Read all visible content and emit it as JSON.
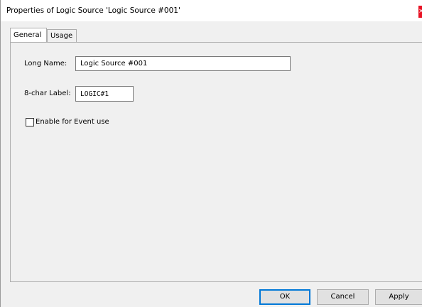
{
  "window": {
    "title": "Properties of Logic Source 'Logic Source #001'",
    "close_label": "×"
  },
  "tabs": [
    {
      "label": "General",
      "active": true
    },
    {
      "label": "Usage",
      "active": false
    }
  ],
  "general": {
    "long_name_label": "Long Name:",
    "long_name_value": "Logic Source #001",
    "short_label_label": "8-char Label:",
    "short_label_value": "LOGIC#1",
    "enable_event_label": "Enable for Event use",
    "enable_event_checked": false
  },
  "buttons": {
    "ok": "OK",
    "cancel": "Cancel",
    "apply": "Apply"
  },
  "colors": {
    "close_button": "#e81123",
    "default_button_border": "#0078d7"
  }
}
